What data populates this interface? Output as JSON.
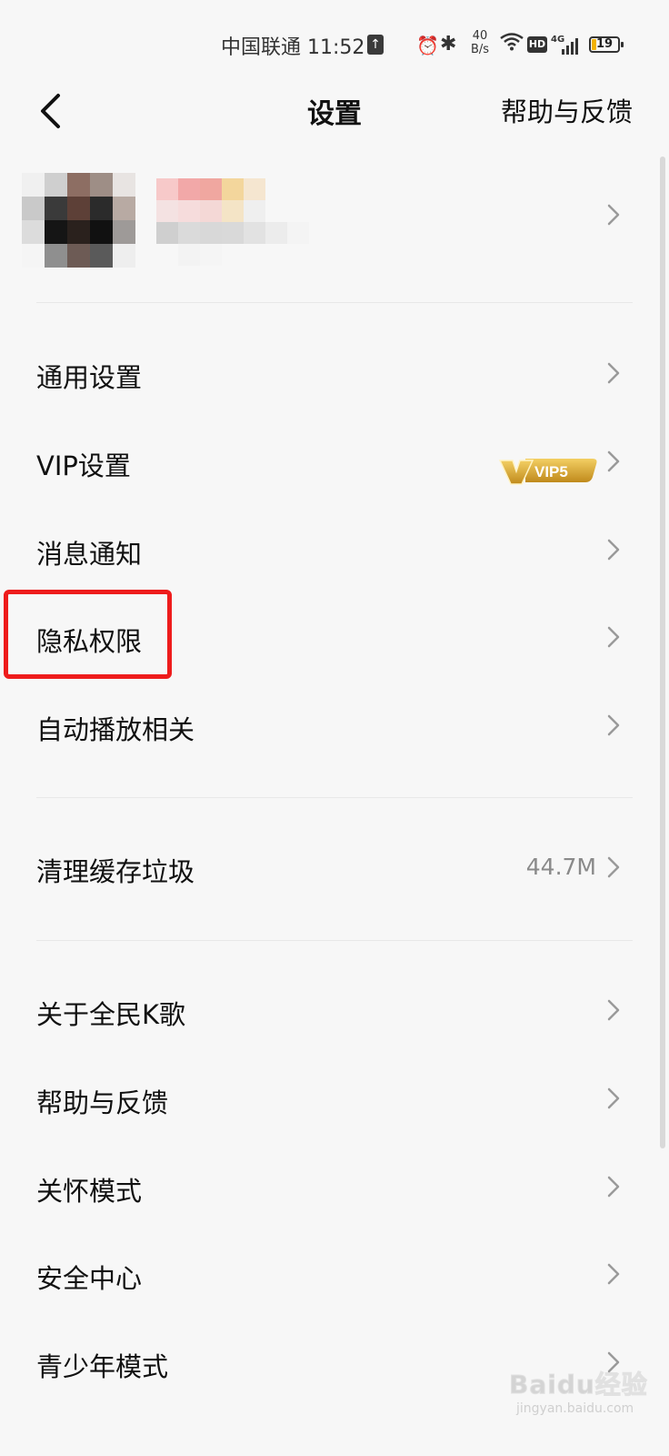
{
  "status_bar": {
    "carrier_time": "中国联通 11:52",
    "net_speed_value": "40",
    "net_speed_unit": "B/s",
    "hd_label": "HD",
    "network": "4G",
    "battery": "19"
  },
  "header": {
    "title": "设置",
    "help_label": "帮助与反馈"
  },
  "profile": {},
  "group1": [
    {
      "label": "通用设置"
    },
    {
      "label": "VIP设置",
      "badge": "VIP5"
    },
    {
      "label": "消息通知"
    },
    {
      "label": "隐私权限"
    },
    {
      "label": "自动播放相关"
    }
  ],
  "group2": [
    {
      "label": "清理缓存垃圾",
      "value": "44.7M"
    }
  ],
  "group3": [
    {
      "label": "关于全民K歌"
    },
    {
      "label": "帮助与反馈"
    },
    {
      "label": "关怀模式"
    },
    {
      "label": "安全中心"
    },
    {
      "label": "青少年模式"
    }
  ],
  "watermark": {
    "logo": "Baidu经验",
    "url": "jingyan.baidu.com"
  },
  "colors": {
    "highlight_border": "#ee1c1c",
    "vip_gold": "#d9a62e",
    "background": "#f7f7f7"
  }
}
